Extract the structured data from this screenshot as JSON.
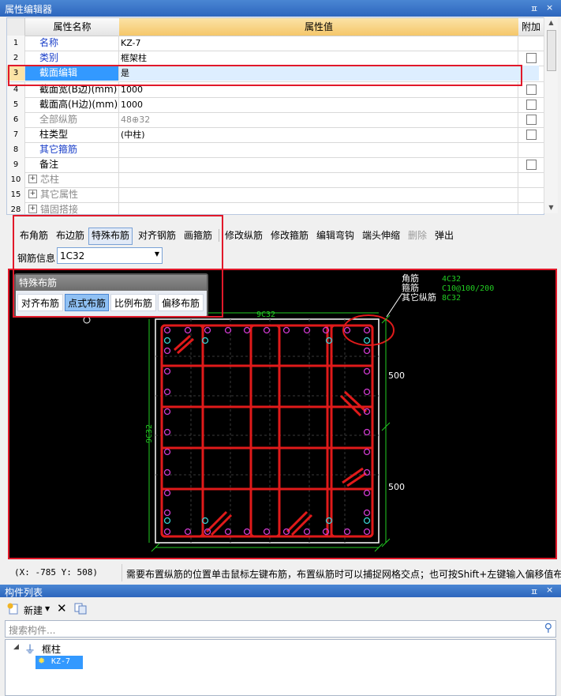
{
  "title_bar": {
    "title": "属性编辑器",
    "pin": "ᵽ",
    "close": "×"
  },
  "grid": {
    "headers": {
      "name": "属性名称",
      "value": "属性值",
      "add": "附加"
    },
    "rows": [
      {
        "num": "1",
        "name": "名称",
        "value": "KZ-7",
        "style": "blue",
        "checkbox": false
      },
      {
        "num": "2",
        "name": "类别",
        "value": "框架柱",
        "style": "blue",
        "checkbox": true
      },
      {
        "num": "3",
        "name": "截面编辑",
        "value": "是",
        "style": "selected",
        "checkbox": false
      },
      {
        "num": "4",
        "name": "截面宽(B边)(mm)",
        "value": "1000",
        "style": "normal",
        "checkbox": true
      },
      {
        "num": "5",
        "name": "截面高(H边)(mm)",
        "value": "1000",
        "style": "normal",
        "checkbox": true
      },
      {
        "num": "6",
        "name": "全部纵筋",
        "value": "48⊕32",
        "style": "gray",
        "checkbox": true
      },
      {
        "num": "7",
        "name": "柱类型",
        "value": "(中柱)",
        "style": "normal",
        "checkbox": true
      },
      {
        "num": "8",
        "name": "其它箍筋",
        "value": "",
        "style": "blue",
        "checkbox": false
      },
      {
        "num": "9",
        "name": "备注",
        "value": "",
        "style": "normal",
        "checkbox": true
      },
      {
        "num": "10",
        "name": "芯柱",
        "value": "",
        "style": "gray-exp",
        "checkbox": false
      },
      {
        "num": "15",
        "name": "其它属性",
        "value": "",
        "style": "gray-exp",
        "checkbox": false
      },
      {
        "num": "28",
        "name": "锚固搭接",
        "value": "",
        "style": "gray-exp",
        "checkbox": false
      }
    ]
  },
  "toolbar": {
    "buttons": [
      "布角筋",
      "布边筋",
      "特殊布筋",
      "对齐钢筋",
      "画箍筋",
      "修改纵筋",
      "修改箍筋",
      "编辑弯钩",
      "端头伸缩",
      "删除",
      "弹出"
    ],
    "active": "特殊布筋",
    "rebar_info_label": "钢筋信息",
    "rebar_info_value": "1C32"
  },
  "special_panel": {
    "title": "特殊布筋",
    "buttons": [
      "对齐布筋",
      "点式布筋",
      "比例布筋",
      "偏移布筋"
    ],
    "active": "点式布筋"
  },
  "canvas": {
    "legend_labels": [
      "角筋",
      "箍筋",
      "其它纵筋"
    ],
    "legend_values": [
      "4C32",
      "C10@100/200",
      "8C32"
    ],
    "top_label": "9C32",
    "left_label": "9C32",
    "dim_top": "500",
    "dim_bottom": "500",
    "colors": {
      "rebar": "#e01a1a",
      "dot_magenta": "#d23bd2",
      "dot_cyan": "#3ad3d3",
      "dim": "#22cc22",
      "outline": "#ffffff"
    }
  },
  "status": {
    "coords": "(X: -785 Y: 508)",
    "message": "需要布置纵筋的位置单击鼠标左键布筋，布置纵筋时可以捕捉网格交点；也可按Shift+左键输入偏移值布"
  },
  "component_list": {
    "title": "构件列表",
    "new_label": "新建",
    "search_placeholder": "搜索构件...",
    "tree_root": "框柱",
    "tree_item": "KZ-7"
  }
}
